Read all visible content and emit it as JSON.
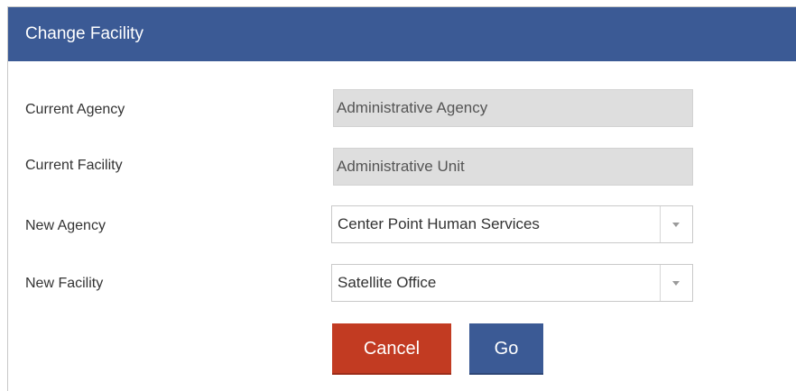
{
  "dialog": {
    "title": "Change Facility"
  },
  "form": {
    "current_agency": {
      "label": "Current Agency",
      "value": "Administrative Agency"
    },
    "current_facility": {
      "label": "Current Facility",
      "value": "Administrative Unit"
    },
    "new_agency": {
      "label": "New Agency",
      "selected": "Center Point Human Services"
    },
    "new_facility": {
      "label": "New Facility",
      "selected": "Satellite Office"
    }
  },
  "buttons": {
    "cancel_label": "Cancel",
    "go_label": "Go"
  },
  "colors": {
    "header": "#3b5a95",
    "cancel": "#c23b22",
    "go": "#3b5a95",
    "readonly_field": "#dedede"
  },
  "icons": {
    "dropdown": "chevron-down-icon"
  }
}
